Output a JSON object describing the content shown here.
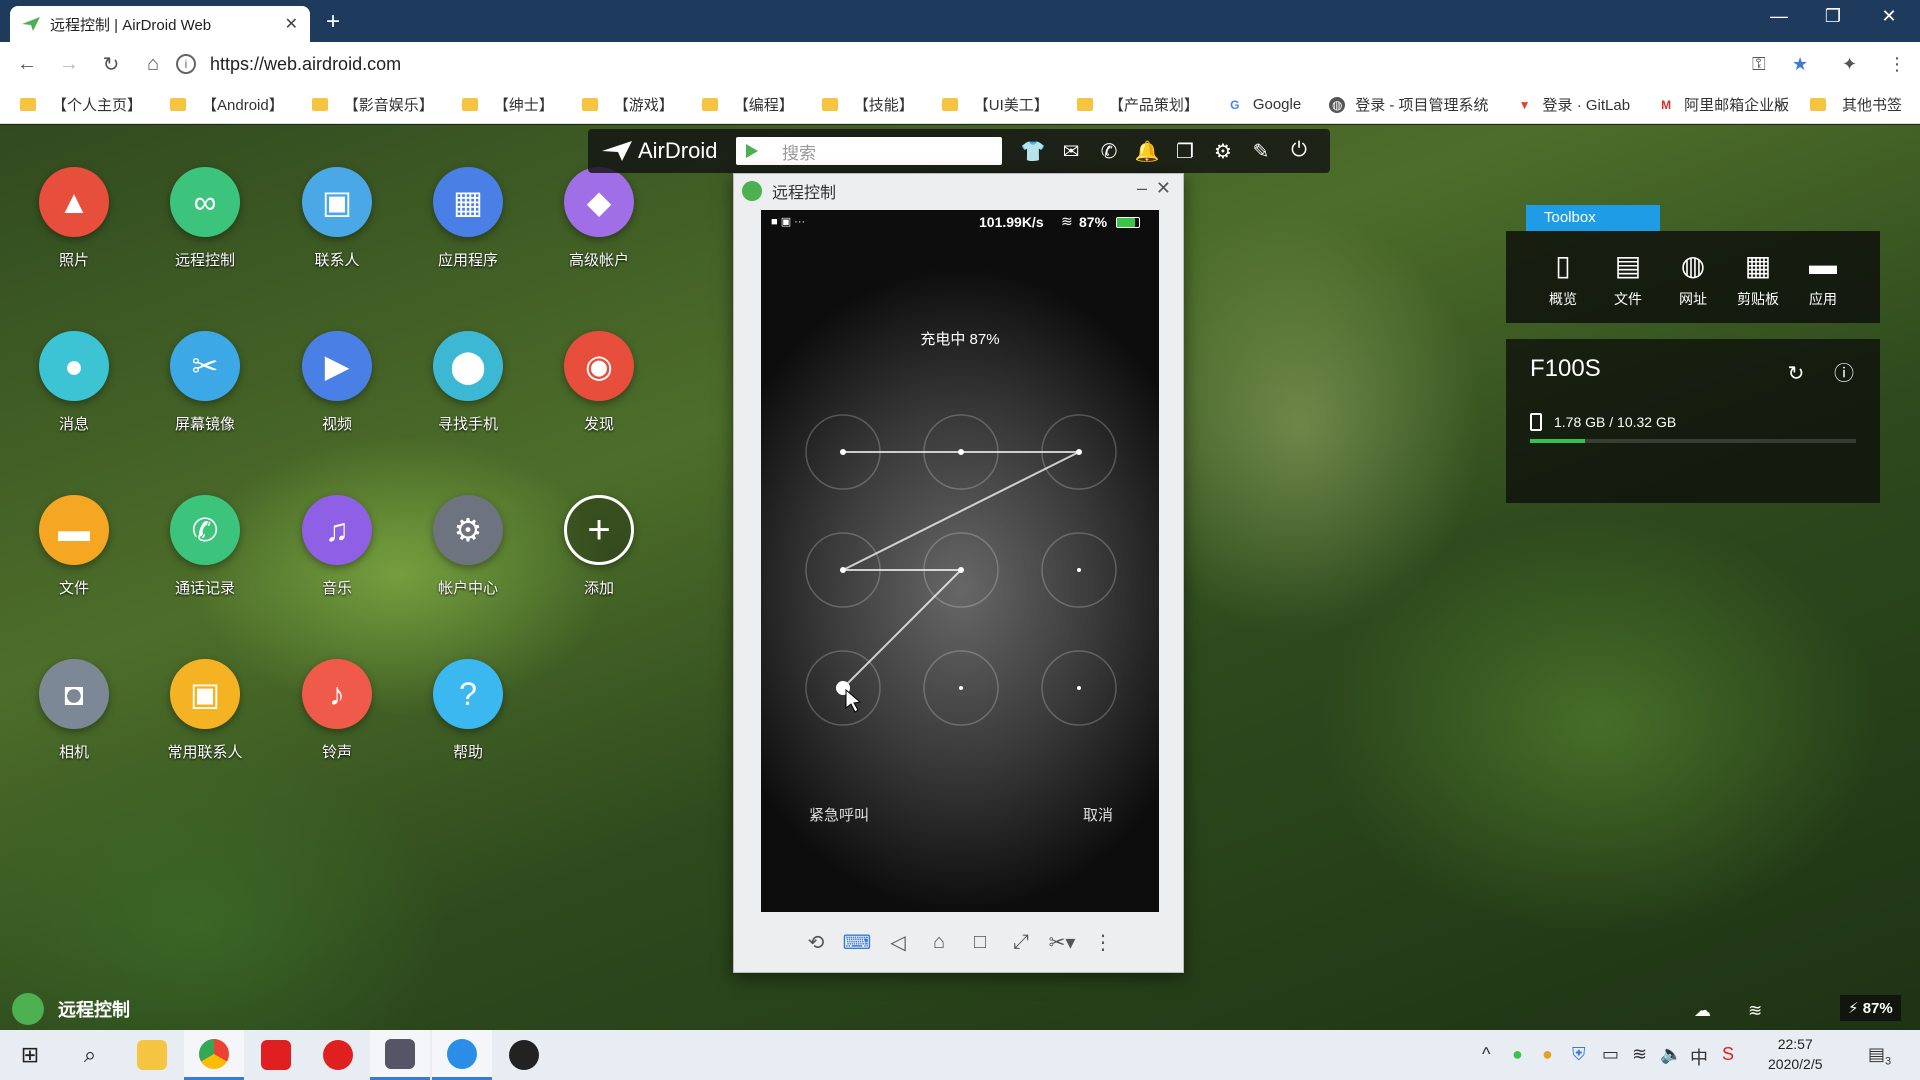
{
  "browser": {
    "tab_title": "远程控制 | AirDroid Web",
    "url": "https://web.airdroid.com",
    "bookmarks": [
      "【个人主页】",
      "【Android】",
      "【影音娱乐】",
      "【绅士】",
      "【游戏】",
      "【编程】",
      "【技能】",
      "【UI美工】",
      "【产品策划】",
      "Google",
      "登录 - 项目管理系统",
      "登录 · GitLab",
      "阿里邮箱企业版"
    ],
    "more_bookmarks": "»",
    "other_bookmarks": "其他书签"
  },
  "airbar": {
    "logo": "AirDroid",
    "search_placeholder": "搜索",
    "icons": [
      "shirt-icon",
      "mail-icon",
      "phone-icon",
      "bell-icon",
      "devices-icon",
      "gear-icon",
      "edit-icon",
      "power-icon"
    ]
  },
  "apps": [
    {
      "label": "照片",
      "color": "#e84e3c",
      "icon": "photo-icon"
    },
    {
      "label": "远程控制",
      "color": "#3cc47c",
      "icon": "binoculars-icon"
    },
    {
      "label": "联系人",
      "color": "#4aa8e6",
      "icon": "contact-icon"
    },
    {
      "label": "应用程序",
      "color": "#4a7fe6",
      "icon": "apps-icon"
    },
    {
      "label": "高级帐户",
      "color": "#a06ee6",
      "icon": "diamond-icon"
    },
    {
      "label": "消息",
      "color": "#3cc4d4",
      "icon": "chat-icon"
    },
    {
      "label": "屏幕镜像",
      "color": "#3ca8e6",
      "icon": "scissors-icon"
    },
    {
      "label": "视频",
      "color": "#4a80e6",
      "icon": "play-icon"
    },
    {
      "label": "寻找手机",
      "color": "#3cb8d4",
      "icon": "pin-icon"
    },
    {
      "label": "发现",
      "color": "#e84e3c",
      "icon": "planet-icon"
    },
    {
      "label": "文件",
      "color": "#f5a623",
      "icon": "folder-icon"
    },
    {
      "label": "通话记录",
      "color": "#3cc47c",
      "icon": "call-icon"
    },
    {
      "label": "音乐",
      "color": "#8f5fe6",
      "icon": "music-icon"
    },
    {
      "label": "帐户中心",
      "color": "#6d7480",
      "icon": "gear-icon"
    },
    {
      "label": "添加",
      "color": "transparent",
      "icon": "add-icon"
    },
    {
      "label": "相机",
      "color": "#7c8896",
      "icon": "camera-icon"
    },
    {
      "label": "常用联系人",
      "color": "#f5b323",
      "icon": "favorite-contact-icon"
    },
    {
      "label": "铃声",
      "color": "#f05a4a",
      "icon": "bell-icon"
    },
    {
      "label": "帮助",
      "color": "#3cb8f0",
      "icon": "help-icon"
    }
  ],
  "remote": {
    "title": "远程控制",
    "speed": "101.99K/s",
    "battery": "87%",
    "charging_text": "充电中 87%",
    "emergency": "紧急呼叫",
    "cancel": "取消",
    "tools": [
      "rotate-icon",
      "keyboard-icon",
      "back-icon",
      "home-icon",
      "recent-icon",
      "fullscreen-icon",
      "screenshot-icon",
      "more-icon"
    ]
  },
  "toolbox": {
    "tab": "Toolbox",
    "items": [
      {
        "label": "概览",
        "icon": "phone-icon"
      },
      {
        "label": "文件",
        "icon": "file-icon"
      },
      {
        "label": "网址",
        "icon": "globe-icon"
      },
      {
        "label": "剪贴板",
        "icon": "clipboard-icon"
      },
      {
        "label": "应用",
        "icon": "app-box-icon"
      }
    ]
  },
  "device": {
    "name": "F100S",
    "storage": "1.78 GB / 10.32 GB",
    "storage_used_fraction": 0.17
  },
  "bottom": {
    "label": "远程控制",
    "battery": "87%"
  },
  "taskbar": {
    "time": "22:57",
    "date": "2020/2/5",
    "notifications": "3"
  }
}
